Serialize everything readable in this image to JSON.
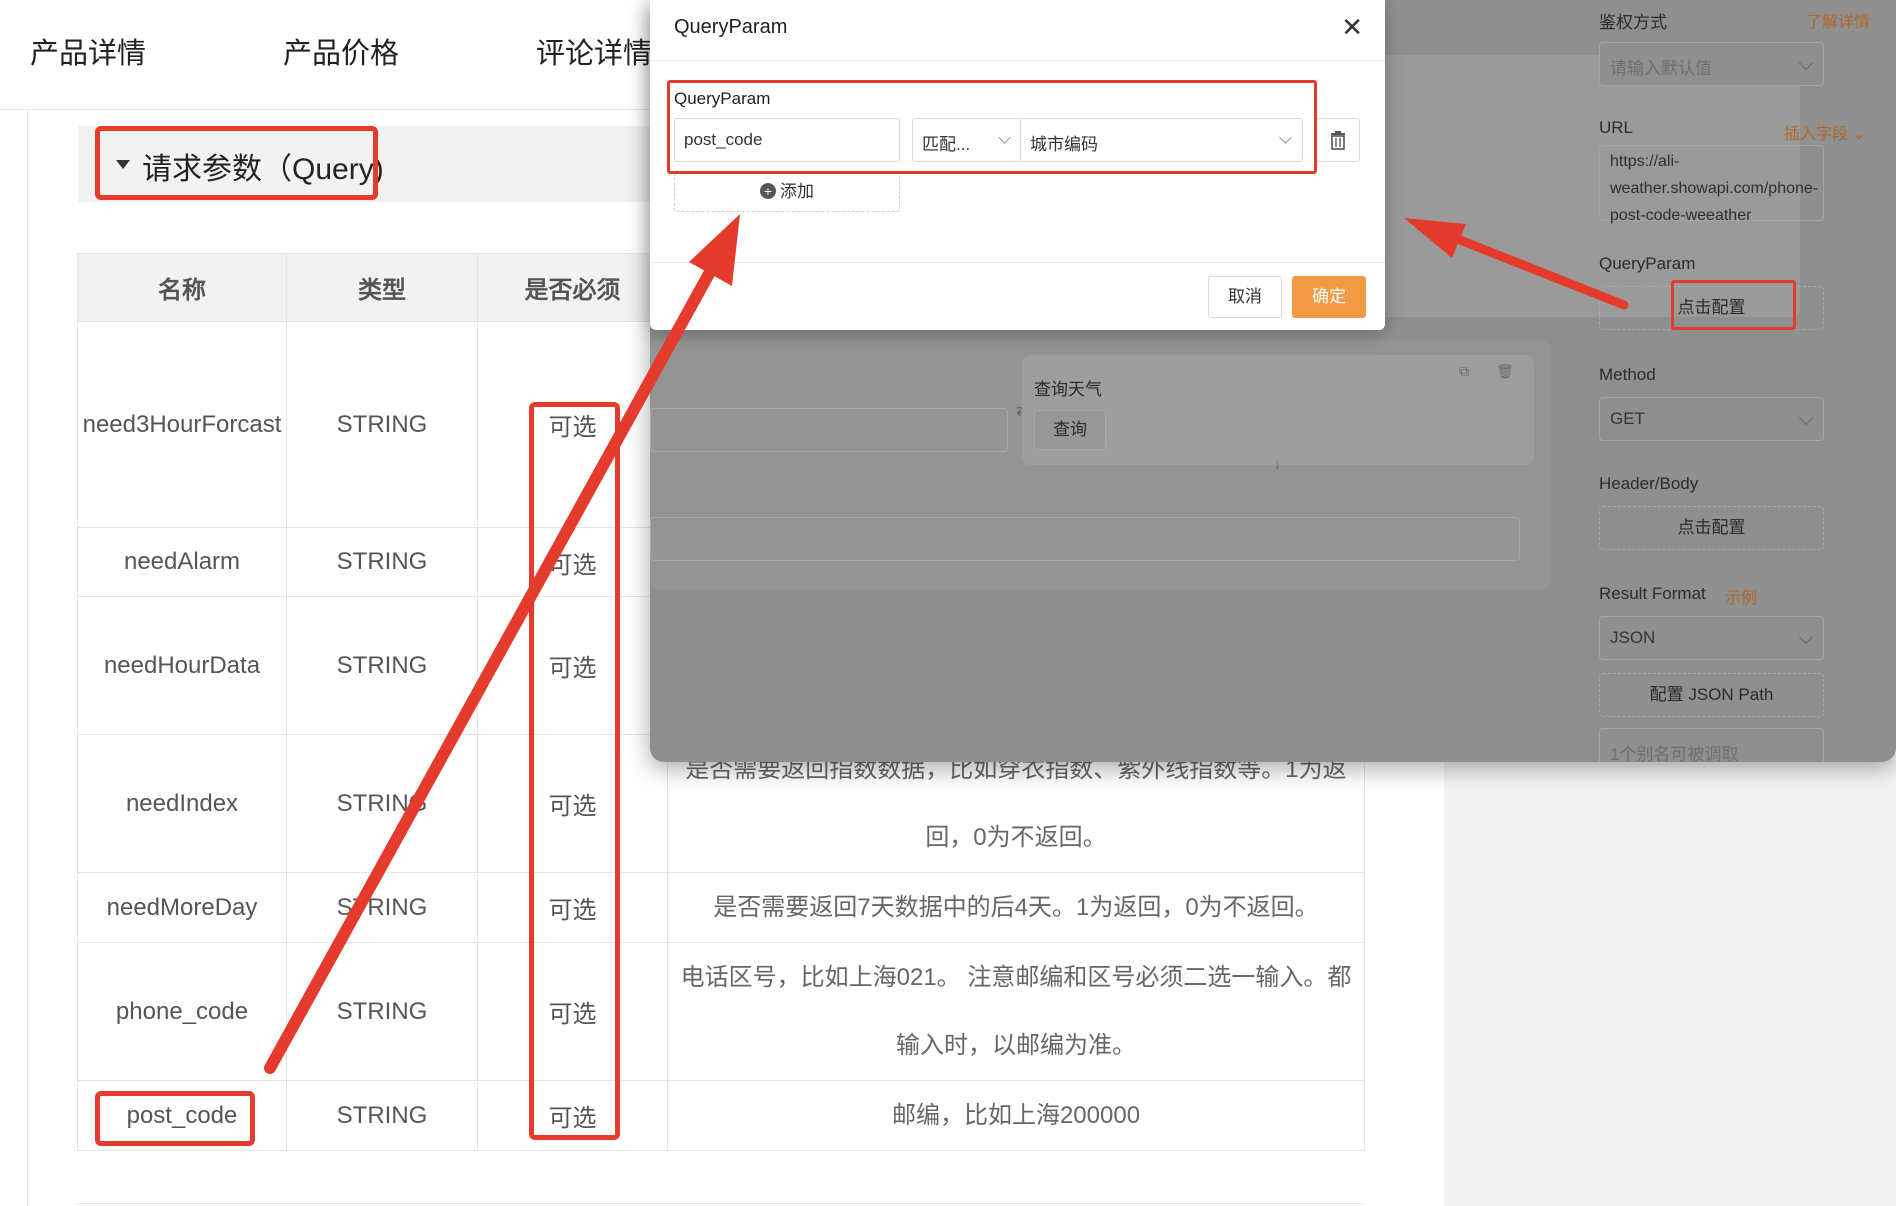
{
  "tabs": [
    "产品详情",
    "产品价格",
    "评论详情"
  ],
  "section": {
    "title": "请求参数（Query)"
  },
  "table": {
    "headers": [
      "名称",
      "类型",
      "是否必须"
    ],
    "rows": [
      {
        "name": "need3HourForcast",
        "type": "STRING",
        "required": "可选",
        "desc": ""
      },
      {
        "name": "needAlarm",
        "type": "STRING",
        "required": "可选",
        "desc": ""
      },
      {
        "name": "needHourData",
        "type": "STRING",
        "required": "可选",
        "desc": ""
      },
      {
        "name": "needIndex",
        "type": "STRING",
        "required": "可选",
        "desc_lines": [
          "是否需要返回指数数据，比如穿衣指数、紫外线指数等。1为返",
          "回，0为不返回。"
        ]
      },
      {
        "name": "needMoreDay",
        "type": "STRING",
        "required": "可选",
        "desc": "是否需要返回7天数据中的后4天。1为返回，0为不返回。"
      },
      {
        "name": "phone_code",
        "type": "STRING",
        "required": "可选",
        "desc_lines": [
          "电话区号，比如上海021。 注意邮编和区号必须二选一输入。都",
          "输入时，以邮编为准。"
        ]
      },
      {
        "name": "post_code",
        "type": "STRING",
        "required": "可选",
        "desc": "邮编，比如上海200000"
      }
    ]
  },
  "editor": {
    "node_title": "查询天气",
    "node_button": "查询"
  },
  "config": {
    "auth_label": "鉴权方式",
    "auth_link": "了解详情",
    "auth_placeholder": "请输入默认值",
    "url_label": "URL",
    "url_link": "插入字段",
    "url_lines": [
      "https://ali-",
      "weather.showapi.com/phone-",
      "post-code-weeather"
    ],
    "queryparam_label": "QueryParam",
    "queryparam_button": "点击配置",
    "method_label": "Method",
    "method_value": "GET",
    "headerbody_label": "Header/Body",
    "headerbody_button": "点击配置",
    "result_label": "Result Format",
    "result_link": "示例",
    "result_value": "JSON",
    "jsonpath_button": "配置 JSON Path",
    "alias_placeholder": "1个别名可被调取"
  },
  "modal": {
    "title": "QueryParam",
    "field_label": "QueryParam",
    "param_value": "post_code",
    "match_value": "匹配...",
    "source_value": "城市编码",
    "add_label": "添加",
    "cancel_label": "取消",
    "ok_label": "确定"
  },
  "colors": {
    "accent": "#f39a44",
    "annotation": "#e53b2c",
    "overlay": "#8f8f8f"
  }
}
